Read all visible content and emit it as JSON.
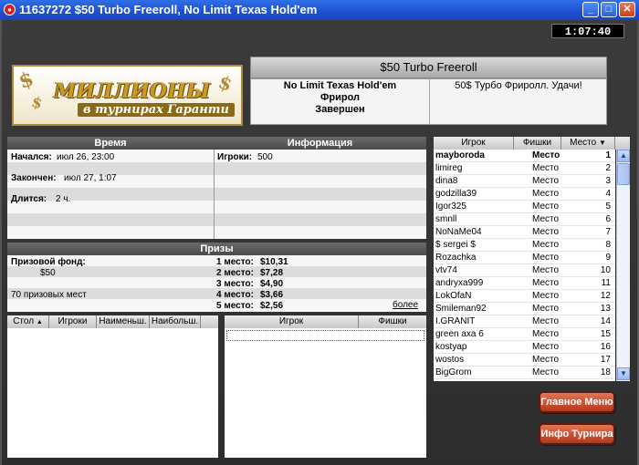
{
  "window": {
    "title": "11637272 $50 Turbo Freeroll, No Limit Texas Hold'em",
    "minimize_glyph": "_",
    "maximize_glyph": "□",
    "close_glyph": "✕"
  },
  "clock": "1:07:40",
  "logo": {
    "main": "МИЛЛИОНЫ",
    "sub": "в турнирах Гаранти",
    "dollar_glyph": "$"
  },
  "tournament": {
    "name": "$50 Turbo Freeroll",
    "game_line1": "No Limit Texas Hold'em",
    "game_line2": "Фрирол",
    "status": "Завершен",
    "message": "50$ Турбо Фриролл. Удачи!"
  },
  "time_panel": {
    "header": "Время",
    "started_label": "Начался:",
    "started_value": "июл 26, 23:00",
    "ended_label": "Закончен:",
    "ended_value": "июл 27, 1:07",
    "duration_label": "Длится:",
    "duration_value": "2 ч."
  },
  "info_panel": {
    "header": "Информация",
    "players_label": "Игроки:",
    "players_value": "500"
  },
  "prizes_panel": {
    "header": "Призы",
    "pool_label": "Призовой фонд:",
    "pool_value": "$50",
    "paid_places": "70 призовых мест",
    "more_link": "более",
    "places": [
      {
        "place": "1 место:",
        "amount": "$10,31"
      },
      {
        "place": "2 место:",
        "amount": "$7,28"
      },
      {
        "place": "3 место:",
        "amount": "$4,90"
      },
      {
        "place": "4 место:",
        "amount": "$3,66"
      },
      {
        "place": "5 место:",
        "amount": "$2,56"
      }
    ]
  },
  "tables_list": {
    "columns": [
      "Стол",
      "Игроки",
      "Наименьш.",
      "Наибольш."
    ],
    "sort_glyph": "▲"
  },
  "table_players": {
    "columns": [
      "Игрок",
      "Фишки"
    ]
  },
  "players": {
    "columns": [
      "Игрок",
      "Фишки",
      "Место"
    ],
    "sort_glyph": "▼",
    "rows": [
      {
        "name": "mayboroda",
        "chips": "Место",
        "place": "1"
      },
      {
        "name": "limireg",
        "chips": "Место",
        "place": "2"
      },
      {
        "name": "dina8",
        "chips": "Место",
        "place": "3"
      },
      {
        "name": "godzilla39",
        "chips": "Место",
        "place": "4"
      },
      {
        "name": "Igor325",
        "chips": "Место",
        "place": "5"
      },
      {
        "name": "smnll",
        "chips": "Место",
        "place": "6"
      },
      {
        "name": "NoNaMe04",
        "chips": "Место",
        "place": "7"
      },
      {
        "name": "$ sergei $",
        "chips": "Место",
        "place": "8"
      },
      {
        "name": "Rozachka",
        "chips": "Место",
        "place": "9"
      },
      {
        "name": "vtv74",
        "chips": "Место",
        "place": "10"
      },
      {
        "name": "andryxa999",
        "chips": "Место",
        "place": "11"
      },
      {
        "name": "LokOfaN",
        "chips": "Место",
        "place": "12"
      },
      {
        "name": "Smileman92",
        "chips": "Место",
        "place": "13"
      },
      {
        "name": "I.GRANIT",
        "chips": "Место",
        "place": "14"
      },
      {
        "name": "green axa 6",
        "chips": "Место",
        "place": "15"
      },
      {
        "name": "kostyap",
        "chips": "Место",
        "place": "16"
      },
      {
        "name": "wostos",
        "chips": "Место",
        "place": "17"
      },
      {
        "name": "BigGrom",
        "chips": "Место",
        "place": "18"
      }
    ],
    "scroll_up": "▲",
    "scroll_down": "▼"
  },
  "buttons": {
    "main_menu": "Главное Меню",
    "tournament_info": "Инфо Турнира"
  }
}
